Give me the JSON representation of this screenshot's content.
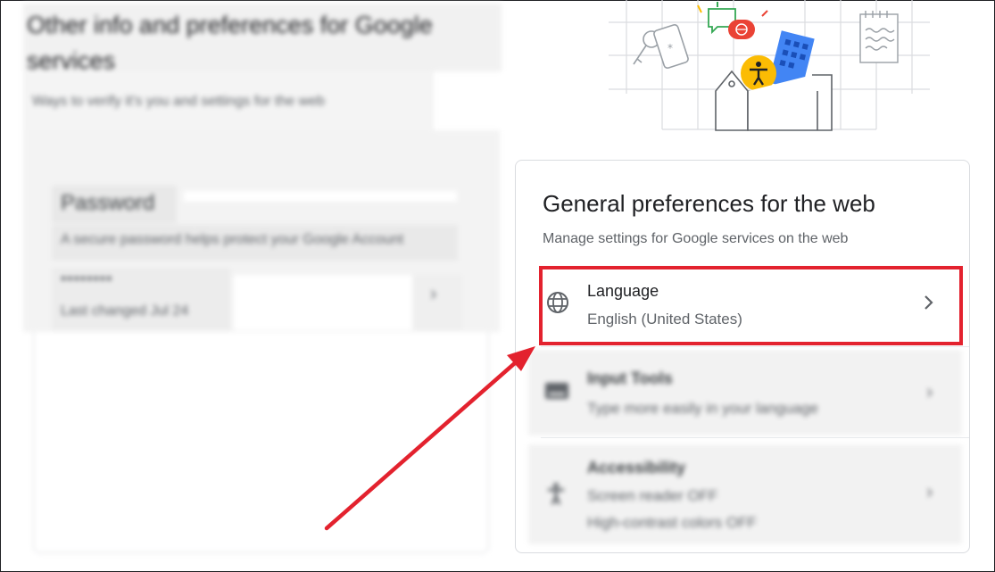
{
  "left_section": {
    "title": "Other info and preferences for Google services",
    "subtitle": "Ways to verify it's you and settings for the web",
    "password": {
      "title": "Password",
      "description": "A secure password helps protect your Google Account",
      "masked_value": "••••••••",
      "last_changed": "Last changed Jul 24"
    }
  },
  "general_preferences": {
    "title": "General preferences for the web",
    "subtitle": "Manage settings for Google services on the web",
    "items": [
      {
        "label": "Language",
        "value": "English (United States)",
        "icon": "globe-icon"
      },
      {
        "label": "Input Tools",
        "value": "Type more easily in your language",
        "icon": "keyboard-icon"
      },
      {
        "label": "Accessibility",
        "value": "Screen reader OFF",
        "value2": "High-contrast colors OFF",
        "icon": "accessibility-icon"
      }
    ]
  },
  "annotation": {
    "highlight_color": "#e3222e",
    "arrow_color": "#e3222e"
  },
  "colors": {
    "text_primary": "#202124",
    "text_secondary": "#5f6368",
    "border": "#dadce0"
  }
}
